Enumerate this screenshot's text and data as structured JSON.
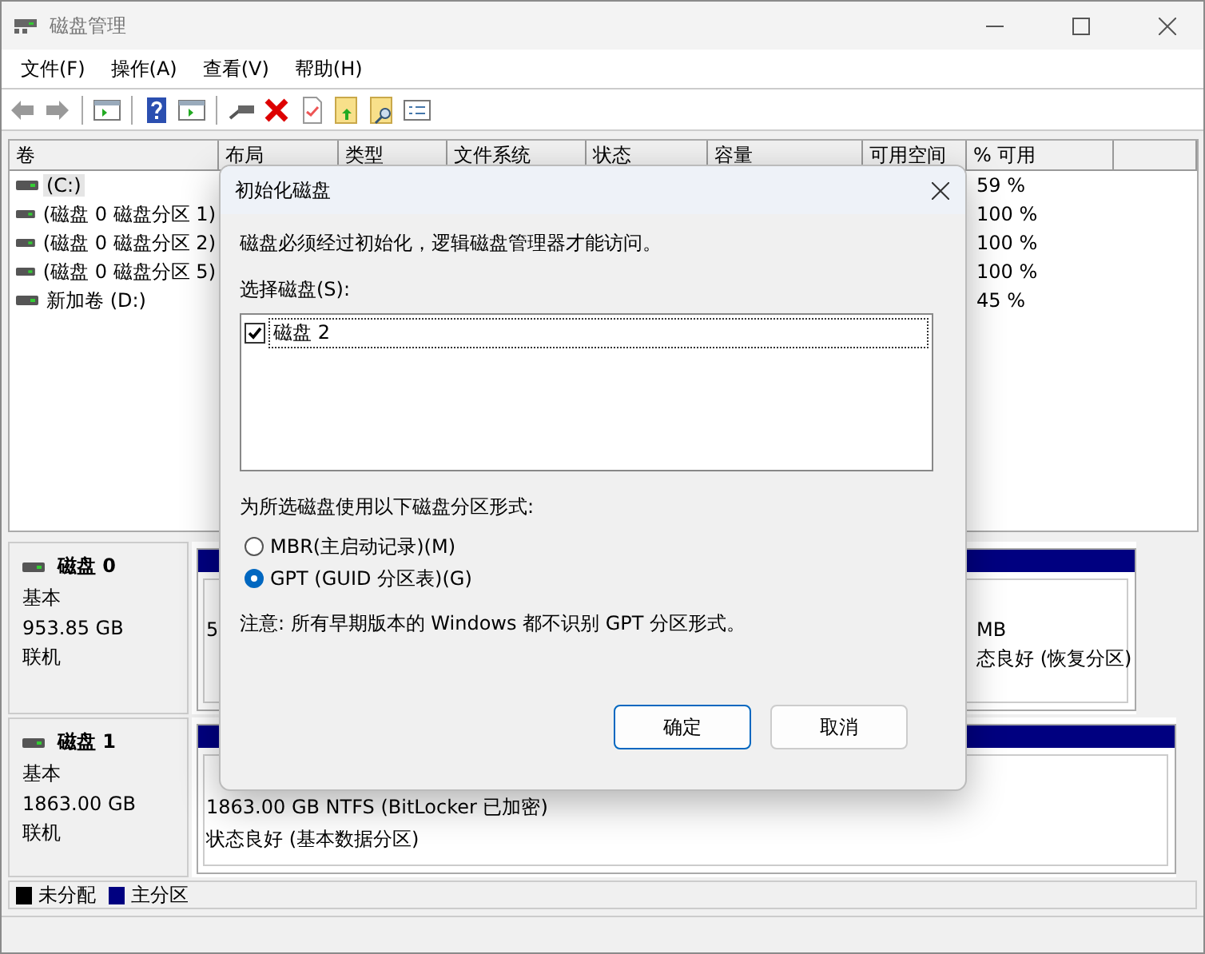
{
  "window": {
    "title": "磁盘管理"
  },
  "menu": [
    "文件(F)",
    "操作(A)",
    "查看(V)",
    "帮助(H)"
  ],
  "table": {
    "columns": [
      "卷",
      "布局",
      "类型",
      "文件系统",
      "状态",
      "容量",
      "可用空间",
      "% 可用"
    ],
    "rows": [
      {
        "volume": "(C:)",
        "free_percent": "59 %",
        "selected": true
      },
      {
        "volume": "(磁盘 0 磁盘分区 1)",
        "free_percent": "100 %",
        "selected": false
      },
      {
        "volume": "(磁盘 0 磁盘分区 2)",
        "free_percent": "100 %",
        "selected": false
      },
      {
        "volume": "(磁盘 0 磁盘分区 5)",
        "free_percent": "100 %",
        "selected": false
      },
      {
        "volume": "新加卷 (D:)",
        "free_percent": "45 %",
        "selected": false
      }
    ]
  },
  "disks": [
    {
      "name": "磁盘 0",
      "type": "基本",
      "size": "953.85 GB",
      "status": "联机",
      "partitions": [
        {
          "lines": [
            "5"
          ]
        },
        {
          "lines": [
            "MB",
            "态良好 (恢复分区)"
          ]
        }
      ]
    },
    {
      "name": "磁盘 1",
      "type": "基本",
      "size": "1863.00 GB",
      "status": "联机",
      "partitions": [
        {
          "lines": [
            "1863.00 GB NTFS (BitLocker 已加密)",
            "状态良好 (基本数据分区)"
          ]
        }
      ]
    }
  ],
  "legend": [
    {
      "label": "未分配",
      "color": "#000000"
    },
    {
      "label": "主分区",
      "color": "#000080"
    }
  ],
  "dialog": {
    "title": "初始化磁盘",
    "message": "磁盘必须经过初始化，逻辑磁盘管理器才能访问。",
    "select_label": "选择磁盘(S):",
    "disks": [
      {
        "label": "磁盘 2",
        "checked": true
      }
    ],
    "style_label": "为所选磁盘使用以下磁盘分区形式:",
    "styles": [
      {
        "label": "MBR(主启动记录)(M)",
        "selected": false
      },
      {
        "label": "GPT (GUID 分区表)(G)",
        "selected": true
      }
    ],
    "note": "注意: 所有早期版本的 Windows 都不识别 GPT 分区形式。",
    "buttons": [
      {
        "label": "确定",
        "default": true
      },
      {
        "label": "取消",
        "default": false
      }
    ]
  }
}
